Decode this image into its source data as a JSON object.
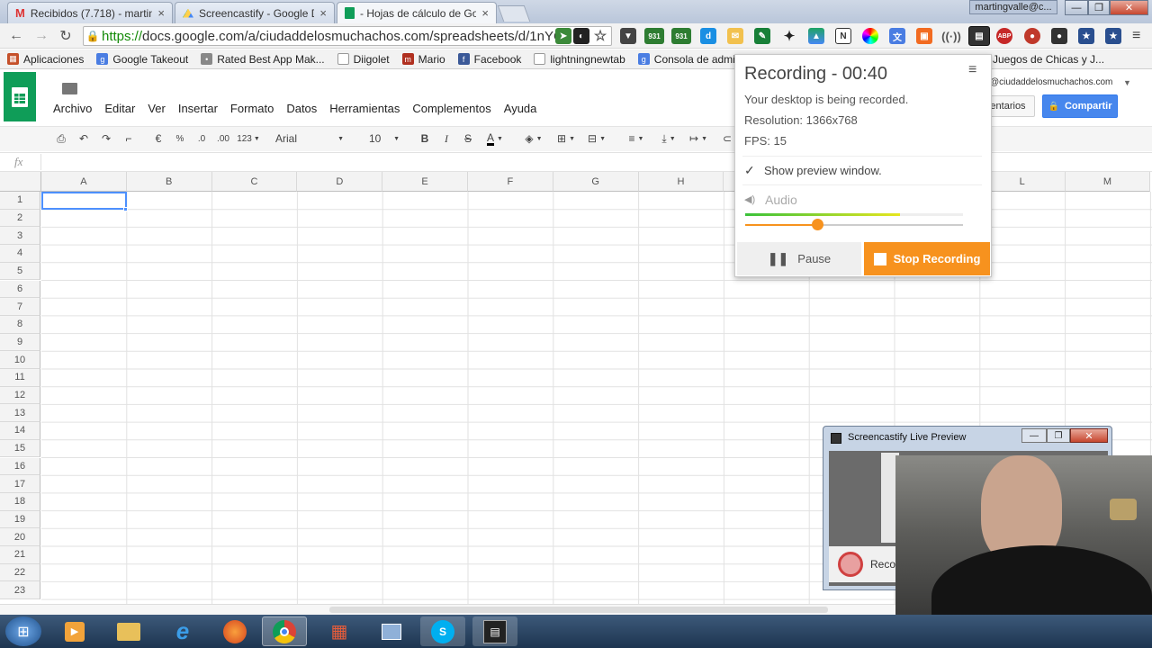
{
  "tabs": [
    {
      "title": "Recibidos (7.718) - martin",
      "close": "×",
      "icon": "gmail-icon"
    },
    {
      "title": "Screencastify - Google Dri",
      "close": "×",
      "icon": "drive-icon"
    },
    {
      "title": "- Hojas de cálculo de Goo",
      "close": "×",
      "icon": "sheets-icon"
    }
  ],
  "window": {
    "user": "martingvalle@c...",
    "min": "—",
    "max": "❐",
    "close": "✕"
  },
  "omnibox": {
    "scheme": "https://",
    "rest": "docs.google.com/a/ciudaddelosmuchachos.com/spreadsheets/d/1nYC"
  },
  "extensions": {
    "badge1": "931",
    "badge2": "931",
    "abp": "ABP"
  },
  "bookmarks": [
    {
      "label": "Aplicaciones",
      "icon": "apps-grid-icon",
      "color": "#c5502a"
    },
    {
      "label": "Google Takeout",
      "icon": "google-icon",
      "color": "#4a7de2"
    },
    {
      "label": "Rated Best App Mak...",
      "icon": "bookmark-icon",
      "color": "#888888"
    },
    {
      "label": "Diigolet",
      "icon": "page-icon",
      "color": "#999999"
    },
    {
      "label": "Mario",
      "icon": "mario-icon",
      "color": "#b03020"
    },
    {
      "label": "Facebook",
      "icon": "facebook-icon",
      "color": "#3b5998"
    },
    {
      "label": "lightningnewtab",
      "icon": "page-icon",
      "color": "#999999"
    },
    {
      "label": "Consola de administ...",
      "icon": "google-icon",
      "color": "#4a7de2"
    }
  ],
  "bookmark_extra": "Juegos de Chicas y J...",
  "sheets": {
    "account": "@ciudaddelosmuchachos.com",
    "comments_btn": "entarios",
    "share_btn": "Compartir",
    "menu": [
      "Archivo",
      "Editar",
      "Ver",
      "Insertar",
      "Formato",
      "Datos",
      "Herramientas",
      "Complementos",
      "Ayuda"
    ],
    "toolbar": {
      "currency": "€",
      "percent": "%",
      "dec_less": ".0",
      "dec_more": ".00",
      "format": "123",
      "font": "Arial",
      "size": "10",
      "bold": "B",
      "italic": "I",
      "strike": "S",
      "textcolor": "A"
    },
    "fx": "fx",
    "columns": [
      "A",
      "B",
      "C",
      "D",
      "E",
      "F",
      "G",
      "H",
      "I",
      "J",
      "K",
      "L",
      "M"
    ],
    "rows": [
      "1",
      "2",
      "3",
      "4",
      "5",
      "6",
      "7",
      "8",
      "9",
      "10",
      "11",
      "12",
      "13",
      "14",
      "15",
      "16",
      "17",
      "18",
      "19",
      "20",
      "21",
      "22",
      "23"
    ]
  },
  "recorder": {
    "title": "Recording - 00:40",
    "desc": "Your desktop is being recorded.",
    "resolution": "Resolution: 1366x768",
    "fps": "FPS: 15",
    "preview_label": "Show preview window.",
    "preview_checked": true,
    "audio_label": "Audio",
    "audio_level": 0.71,
    "audio_volume": 0.33,
    "pause_label": "Pause",
    "stop_label": "Stop Recording",
    "stop_color": "#f7921e"
  },
  "live_preview": {
    "title": "Screencastify Live Preview",
    "record_label": "Reco"
  }
}
